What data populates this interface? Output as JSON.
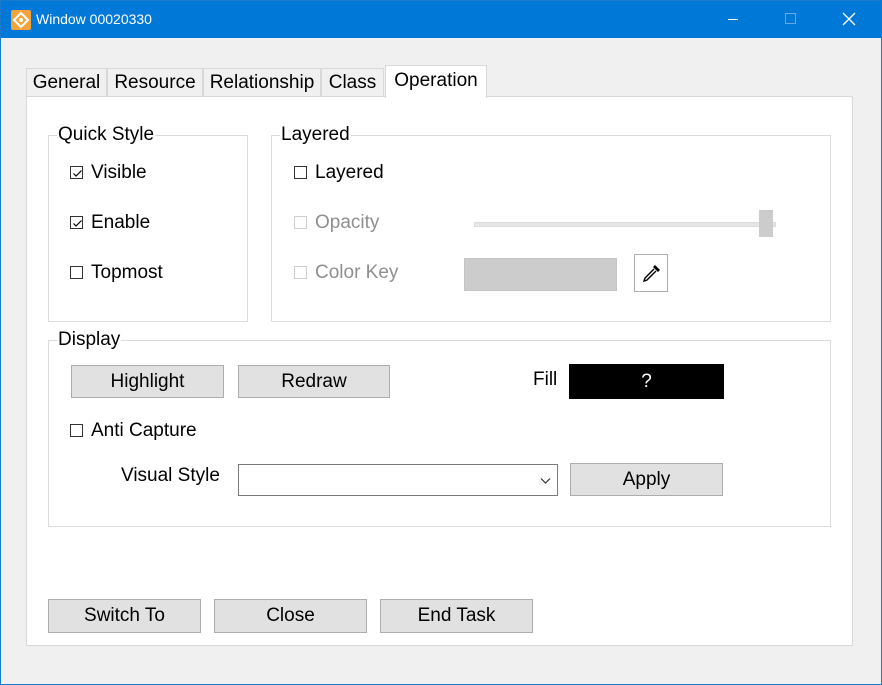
{
  "window": {
    "title": "Window 00020330"
  },
  "tabs": [
    {
      "label": "General"
    },
    {
      "label": "Resource"
    },
    {
      "label": "Relationship"
    },
    {
      "label": "Class"
    },
    {
      "label": "Operation"
    }
  ],
  "active_tab": "Operation",
  "quick_style": {
    "title": "Quick Style",
    "visible": {
      "label": "Visible",
      "checked": true
    },
    "enable": {
      "label": "Enable",
      "checked": true
    },
    "topmost": {
      "label": "Topmost",
      "checked": false
    }
  },
  "layered": {
    "title": "Layered",
    "layered": {
      "label": "Layered",
      "checked": false
    },
    "opacity": {
      "label": "Opacity",
      "checked": false,
      "enabled": false,
      "value": 1.0
    },
    "color_key": {
      "label": "Color Key",
      "checked": false,
      "enabled": false,
      "swatch_color": "#cccccc"
    }
  },
  "display": {
    "title": "Display",
    "highlight_label": "Highlight",
    "redraw_label": "Redraw",
    "fill_label": "Fill",
    "fill_value": "?",
    "fill_color": "#000000",
    "anti_capture": {
      "label": "Anti Capture",
      "checked": false
    },
    "visual_style_label": "Visual Style",
    "visual_style_value": "",
    "apply_label": "Apply"
  },
  "footer": {
    "switch_to_label": "Switch To",
    "close_label": "Close",
    "end_task_label": "End Task"
  },
  "colors": {
    "titlebar": "#0078d7",
    "button_face": "#e1e1e1",
    "disabled_text": "#8f8f8f"
  },
  "icons": [
    "app-icon",
    "minimize-icon",
    "maximize-icon",
    "close-icon",
    "checkmark-icon",
    "eyedropper-icon",
    "chevron-down-icon"
  ]
}
